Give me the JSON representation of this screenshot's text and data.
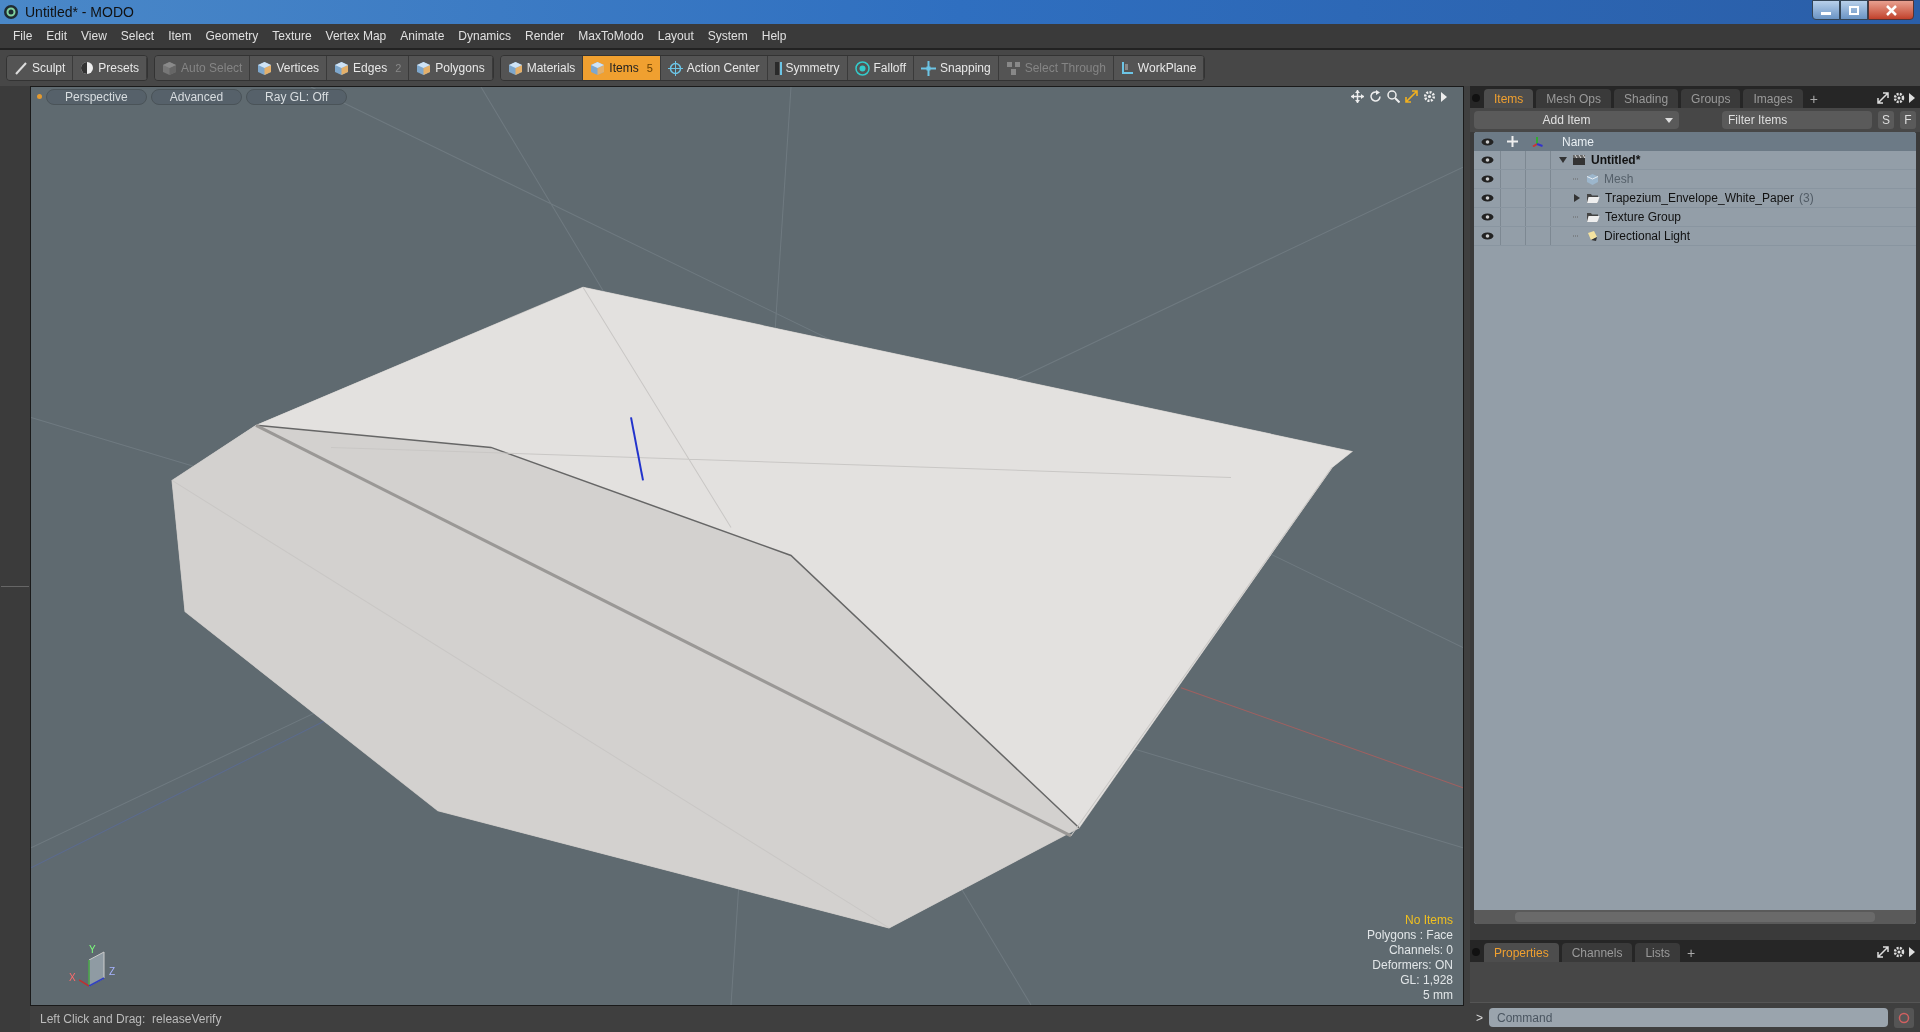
{
  "window": {
    "title": "Untitled* - MODO"
  },
  "menu": [
    "File",
    "Edit",
    "View",
    "Select",
    "Item",
    "Geometry",
    "Texture",
    "Vertex Map",
    "Animate",
    "Dynamics",
    "Render",
    "MaxToModo",
    "Layout",
    "System",
    "Help"
  ],
  "toolbar_groups": [
    [
      {
        "label": "Sculpt",
        "kind": "brush",
        "disabled": false,
        "selected": false
      },
      {
        "label": "Presets",
        "kind": "presets",
        "disabled": false,
        "selected": false
      }
    ],
    [
      {
        "label": "Auto Select",
        "kind": "cube",
        "disabled": true,
        "selected": false
      },
      {
        "label": "Vertices",
        "kind": "cube",
        "disabled": false,
        "selected": false
      },
      {
        "label": "Edges",
        "kind": "cube",
        "disabled": false,
        "selected": false,
        "count": "2"
      },
      {
        "label": "Polygons",
        "kind": "cube",
        "disabled": false,
        "selected": false
      }
    ],
    [
      {
        "label": "Materials",
        "kind": "cube",
        "disabled": false,
        "selected": false
      },
      {
        "label": "Items",
        "kind": "cube",
        "disabled": false,
        "selected": true,
        "count": "5"
      },
      {
        "label": "Action Center",
        "kind": "target",
        "disabled": false,
        "selected": false
      },
      {
        "label": "Symmetry",
        "kind": "symmetry",
        "disabled": false,
        "selected": false
      },
      {
        "label": "Falloff",
        "kind": "falloff",
        "disabled": false,
        "selected": false
      },
      {
        "label": "Snapping",
        "kind": "snap",
        "disabled": false,
        "selected": false
      },
      {
        "label": "Select Through",
        "kind": "through",
        "disabled": true,
        "selected": false
      },
      {
        "label": "WorkPlane",
        "kind": "workplane",
        "disabled": false,
        "selected": false
      }
    ]
  ],
  "viewport": {
    "tabs": [
      "Perspective",
      "Advanced",
      "Ray GL: Off"
    ],
    "info": [
      {
        "text": "No Items",
        "highlight": true
      },
      {
        "text": "Polygons : Face",
        "highlight": false
      },
      {
        "text": "Channels: 0",
        "highlight": false
      },
      {
        "text": "Deformers: ON",
        "highlight": false
      },
      {
        "text": "GL: 1,928",
        "highlight": false
      },
      {
        "text": "5 mm",
        "highlight": false
      }
    ],
    "axis_labels": [
      "X",
      "Y",
      "Z"
    ]
  },
  "panel": {
    "tabs": [
      {
        "label": "Items",
        "selected": true
      },
      {
        "label": "Mesh Ops",
        "selected": false
      },
      {
        "label": "Shading",
        "selected": false
      },
      {
        "label": "Groups",
        "selected": false
      },
      {
        "label": "Images",
        "selected": false
      }
    ],
    "add_tab": "+",
    "add_button": "Add Item",
    "filter": {
      "placeholder": "Filter Items"
    },
    "filter_buttons": [
      "S",
      "F"
    ],
    "name_column": "Name",
    "tree": [
      {
        "label": "Untitled*",
        "kind": "scene",
        "expanded": true,
        "disabled": false,
        "children": [
          {
            "label": "Mesh",
            "kind": "mesh",
            "disabled": true
          },
          {
            "label": "Trapezium_Envelope_White_Paper",
            "kind": "group",
            "expanded": false,
            "disabled": false,
            "count": "(3)"
          },
          {
            "label": "Texture Group",
            "kind": "group",
            "disabled": false
          },
          {
            "label": "Directional Light",
            "kind": "light",
            "disabled": false
          }
        ]
      }
    ]
  },
  "properties": {
    "tabs": [
      {
        "label": "Properties",
        "selected": true
      },
      {
        "label": "Channels",
        "selected": false
      },
      {
        "label": "Lists",
        "selected": false
      }
    ],
    "add_tab": "+"
  },
  "command": {
    "prompt": ">",
    "placeholder": "Command"
  },
  "status_bar": "Left Click and Drag:  releaseVerify"
}
